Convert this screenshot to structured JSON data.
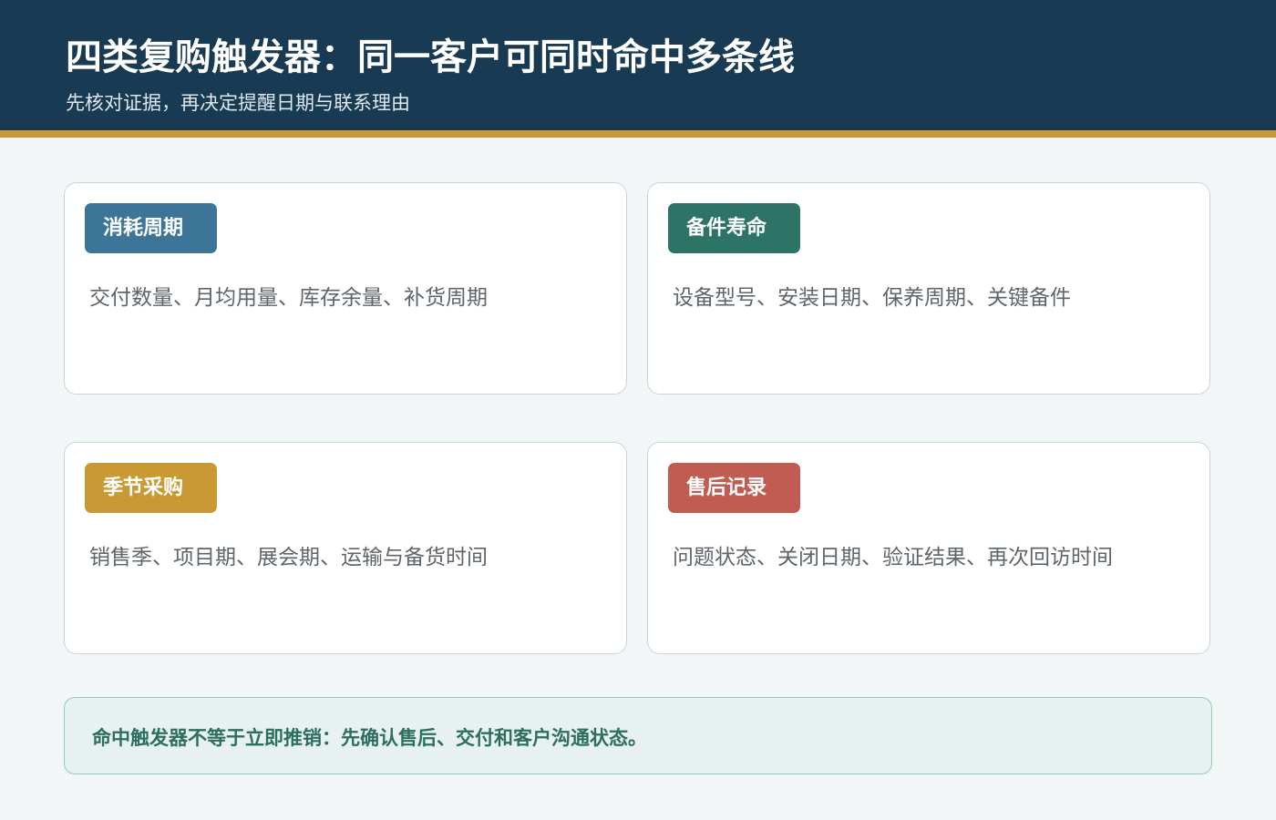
{
  "header": {
    "title": "四类复购触发器：同一客户可同时命中多条线",
    "subtitle": "先核对证据，再决定提醒日期与联系理由"
  },
  "colors": {
    "header_bg": "#183a52",
    "accent_bar": "#c99a34",
    "tag_blue": "#3d7599",
    "tag_green": "#2d7466",
    "tag_gold": "#c99a34",
    "tag_red": "#c05c51"
  },
  "cards": [
    {
      "tag": "消耗周期",
      "text": "交付数量、月均用量、库存余量、补货周期"
    },
    {
      "tag": "备件寿命",
      "text": "设备型号、安装日期、保养周期、关键备件"
    },
    {
      "tag": "季节采购",
      "text": "销售季、项目期、展会期、运输与备货时间"
    },
    {
      "tag": "售后记录",
      "text": "问题状态、关闭日期、验证结果、再次回访时间"
    }
  ],
  "note": {
    "text": "命中触发器不等于立即推销：先确认售后、交付和客户沟通状态。"
  }
}
